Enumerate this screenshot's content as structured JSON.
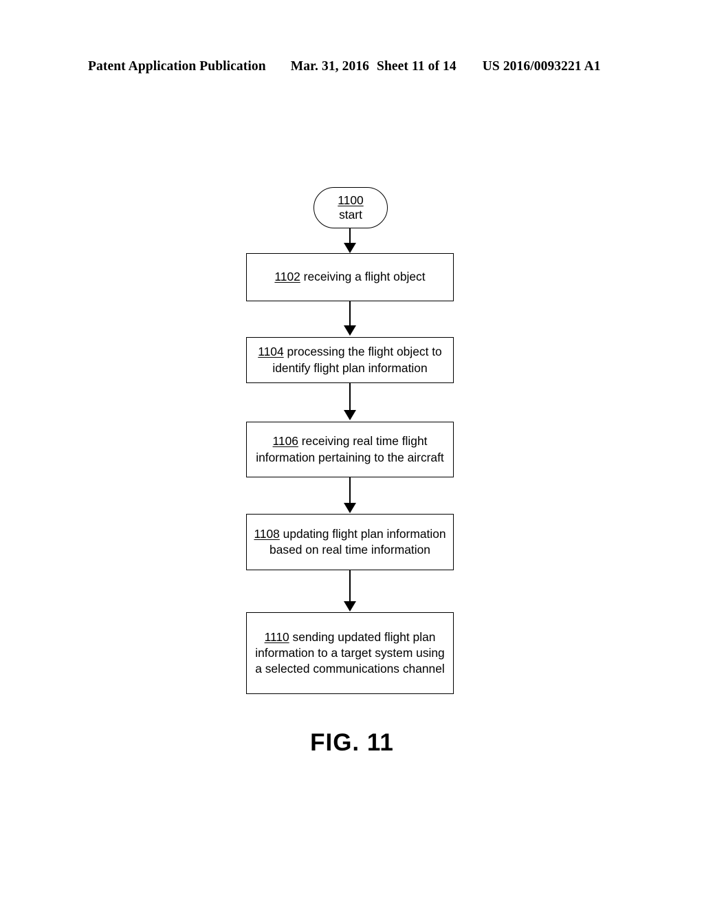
{
  "header": {
    "publication": "Patent Application Publication",
    "date": "Mar. 31, 2016",
    "sheet": "Sheet 11 of 14",
    "patent_number": "US 2016/0093221 A1"
  },
  "figure": {
    "caption": "FIG. 11",
    "type": "flowchart",
    "ink_color": "#000000",
    "background_color": "#ffffff"
  },
  "flowchart": {
    "start": {
      "ref": "1100",
      "label": "start",
      "shape": "rounded-terminator"
    },
    "steps": [
      {
        "ref": "1102",
        "text": " receiving a flight object",
        "full_text": "1102 receiving a flight object",
        "shape": "rectangle"
      },
      {
        "ref": "1104",
        "text": " processing the flight object to identify flight plan information",
        "full_text": "1104 processing the flight object to identify flight plan information",
        "shape": "rectangle"
      },
      {
        "ref": "1106",
        "text": " receiving real time flight information pertaining to the aircraft",
        "full_text": "1106 receiving real time flight information pertaining to the aircraft",
        "shape": "rectangle"
      },
      {
        "ref": "1108",
        "text": " updating flight plan information based on real time information",
        "full_text": "1108 updating flight plan information based on real time information",
        "shape": "rectangle"
      },
      {
        "ref": "1110",
        "text": " sending updated flight plan information to a target system using a selected communications channel",
        "full_text": "1110 sending updated flight plan information to a target system using a selected communications channel",
        "shape": "rectangle"
      }
    ],
    "connectors": [
      {
        "from": "1100",
        "to": "1102",
        "style": "arrow-down"
      },
      {
        "from": "1102",
        "to": "1104",
        "style": "arrow-down"
      },
      {
        "from": "1104",
        "to": "1106",
        "style": "arrow-down"
      },
      {
        "from": "1106",
        "to": "1108",
        "style": "arrow-down"
      },
      {
        "from": "1108",
        "to": "1110",
        "style": "arrow-down"
      }
    ]
  }
}
